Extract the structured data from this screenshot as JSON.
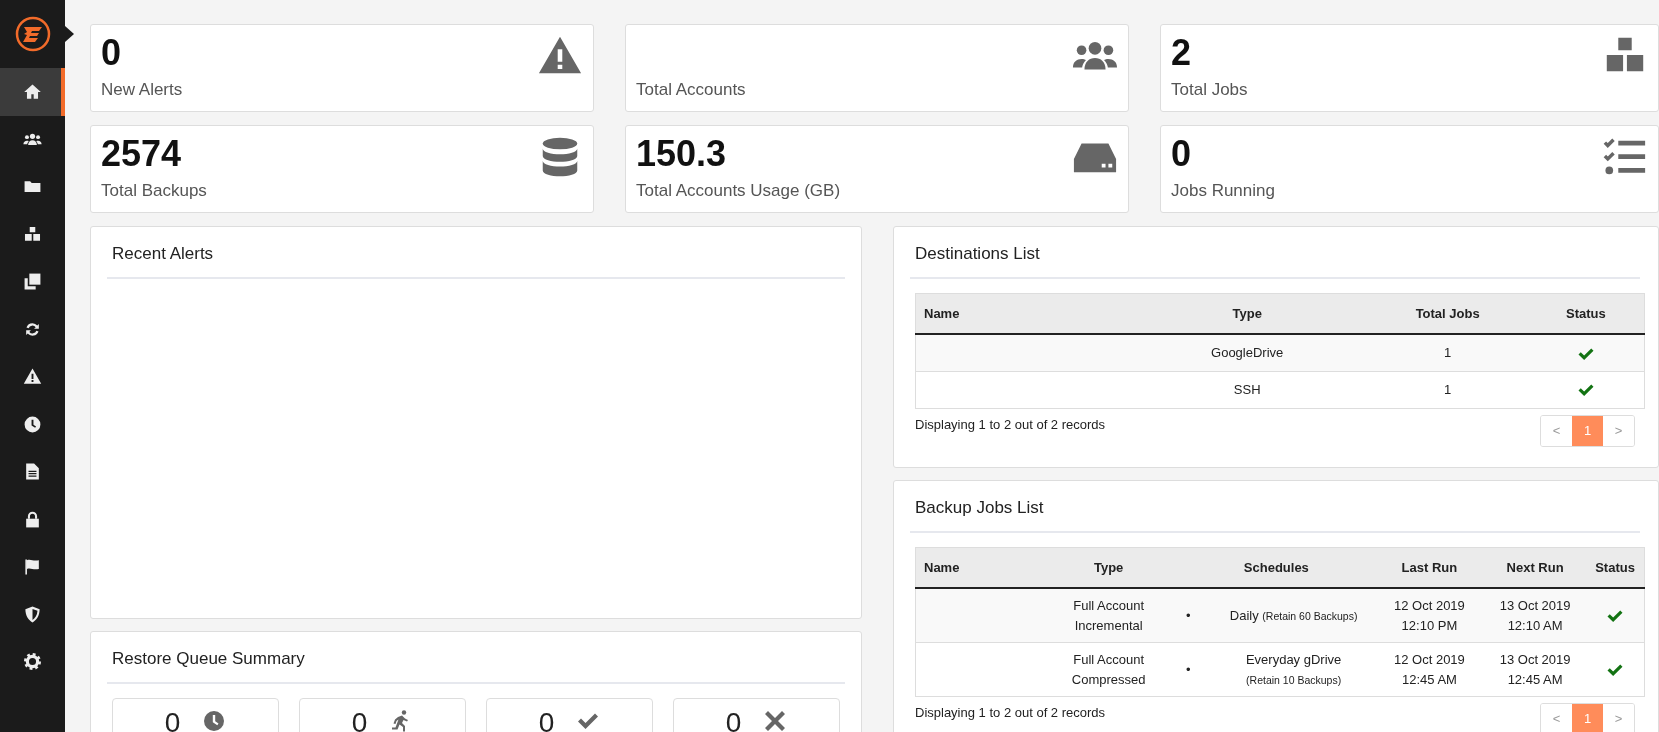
{
  "sidebar": {
    "items": [
      {
        "selected": true
      },
      {
        "selected": false
      },
      {
        "selected": false
      },
      {
        "selected": false
      },
      {
        "selected": false
      },
      {
        "selected": false
      },
      {
        "selected": false
      },
      {
        "selected": false
      },
      {
        "selected": false
      },
      {
        "selected": false
      },
      {
        "selected": false
      },
      {
        "selected": false
      },
      {
        "selected": false
      }
    ]
  },
  "stats": [
    {
      "value": "0",
      "label": "New Alerts"
    },
    {
      "label": "Total Accounts"
    },
    {
      "value": "2",
      "label": "Total Jobs"
    },
    {
      "value": "2574",
      "label": "Total Backups"
    },
    {
      "value": "150.3",
      "label": "Total Accounts Usage (GB)"
    },
    {
      "value": "0",
      "label": "Jobs Running"
    }
  ],
  "recent_alerts": {
    "title": "Recent Alerts"
  },
  "restore_queue": {
    "title": "Restore Queue Summary",
    "counts": [
      "0",
      "0",
      "0",
      "0"
    ]
  },
  "destinations": {
    "title": "Destinations List",
    "columns": [
      "Name",
      "Type",
      "Total Jobs",
      "Status"
    ],
    "rows": [
      {
        "type": "GoogleDrive",
        "total_jobs": "1",
        "status_ok": true
      },
      {
        "type": "SSH",
        "total_jobs": "1",
        "status_ok": true
      }
    ],
    "summary": "Displaying 1 to 2 out of 2 records",
    "pagination": {
      "prev": "<",
      "pages": [
        {
          "label": "1",
          "selected": true
        }
      ],
      "next": ">"
    }
  },
  "backup_jobs": {
    "title": "Backup Jobs List",
    "columns": [
      "Name",
      "Type",
      "Schedules",
      "Last Run",
      "Next Run",
      "Status"
    ],
    "rows": [
      {
        "type": "Full Account Incremental",
        "schedules": [
          {
            "bullet": "•",
            "name": "Daily",
            "note": "(Retain 60 Backups)"
          }
        ],
        "last_run": "12 Oct 2019 12:10 PM",
        "next_run": "13 Oct 2019 12:10 AM",
        "status_ok": true
      },
      {
        "type": "Full Account Compressed",
        "schedules": [
          {
            "bullet": "•",
            "name": "Everyday gDrive",
            "note": "(Retain 10 Backups)"
          }
        ],
        "last_run": "12 Oct 2019 12:45 AM",
        "next_run": "13 Oct 2019 12:45 AM",
        "status_ok": true
      }
    ],
    "summary": "Displaying 1 to 2 out of 2 records",
    "pagination": {
      "prev": "<",
      "pages": [
        {
          "label": "1",
          "selected": true
        }
      ],
      "next": ">"
    }
  }
}
